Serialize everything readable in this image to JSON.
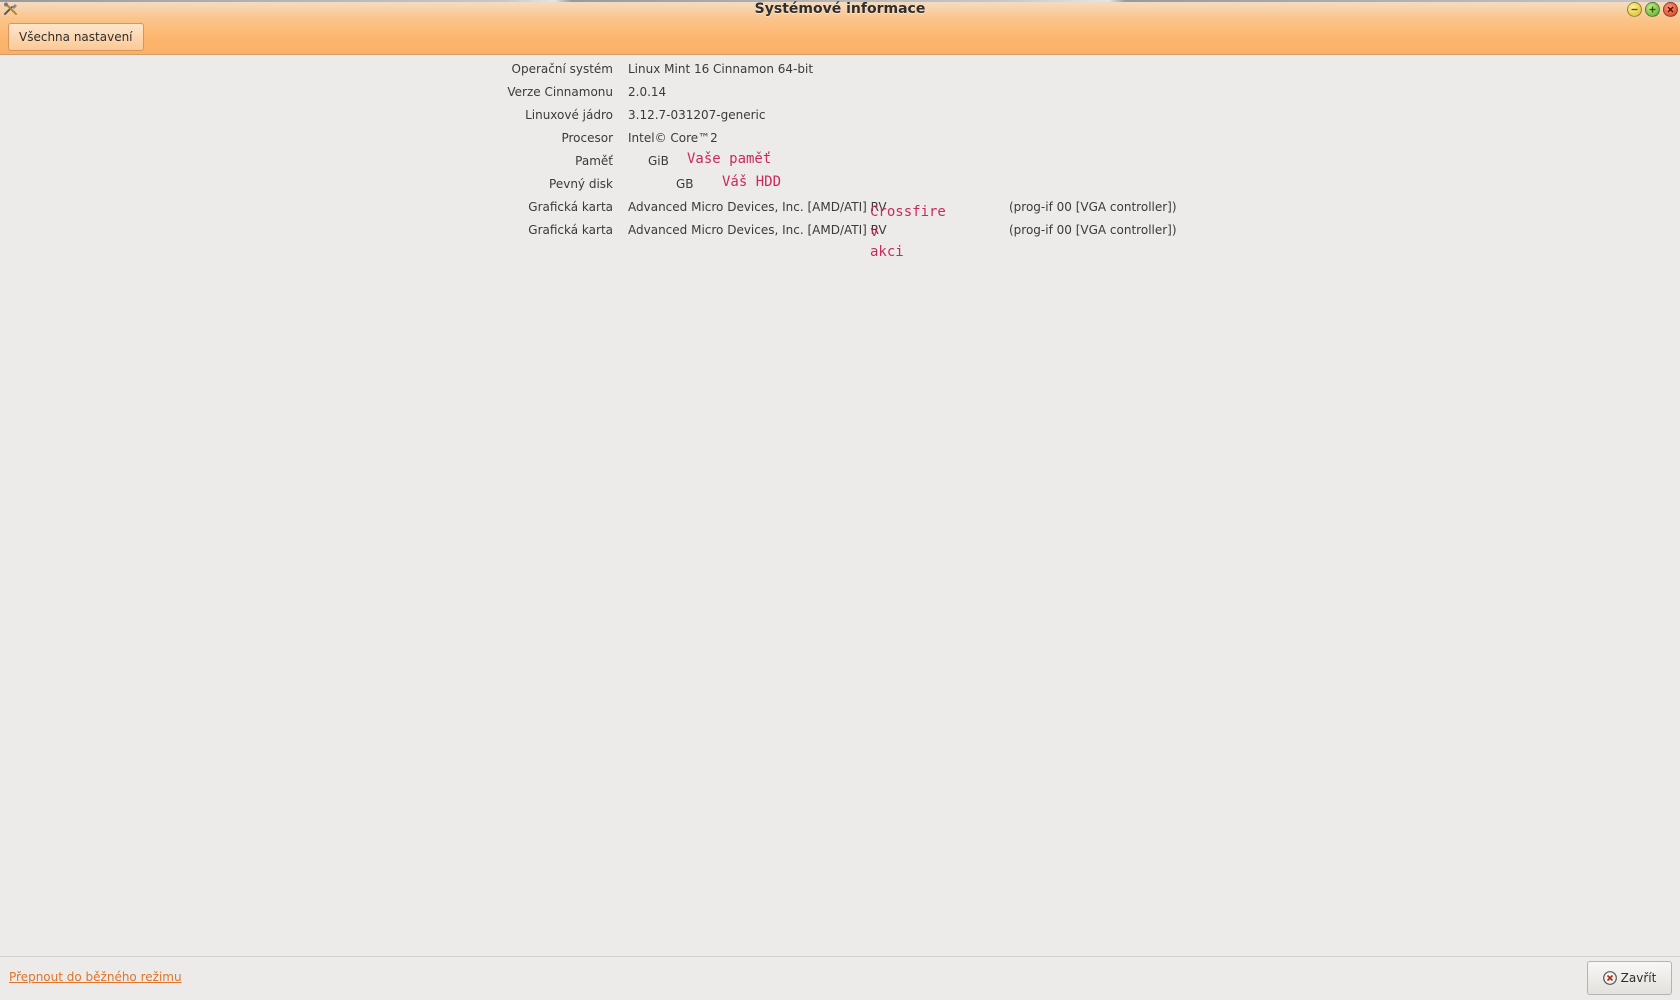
{
  "window": {
    "title": "Systémové informace"
  },
  "toolbar": {
    "all_settings_label": "Všechna nastavení"
  },
  "info_rows": [
    {
      "label": "Operační systém",
      "value": "Linux Mint 16 Cinnamon 64-bit"
    },
    {
      "label": "Verze Cinnamonu",
      "value": "2.0.14"
    },
    {
      "label": "Linuxové jádro",
      "value": "3.12.7-031207-generic"
    },
    {
      "label": "Procesor",
      "value": "Intel© Core™2"
    },
    {
      "label": "Paměť",
      "value": "GiB"
    },
    {
      "label": "Pevný disk",
      "value": "GB"
    },
    {
      "label": "Grafická karta",
      "value": "Advanced Micro Devices, Inc. [AMD/ATI] RV",
      "suffix": "(prog-if 00 [VGA controller])"
    },
    {
      "label": "Grafická karta",
      "value": "Advanced Micro Devices, Inc. [AMD/ATI] RV",
      "suffix": "(prog-if 00 [VGA controller])"
    }
  ],
  "annotations": {
    "memory": "Vaše paměť",
    "disk": "Váš HDD",
    "gpu_line1": "Crossfire",
    "gpu_line2": "v",
    "gpu_line3": "akci"
  },
  "footer": {
    "mode_link": "Přepnout do běžného režimu",
    "close_label": "Zavřít"
  },
  "colors": {
    "header_orange": "#fbb06a",
    "annotation": "#cc2a5a",
    "link": "#e0742a",
    "background": "#ecebe9"
  },
  "icons": {
    "app": "tools-icon",
    "close": "close-circle-icon"
  }
}
